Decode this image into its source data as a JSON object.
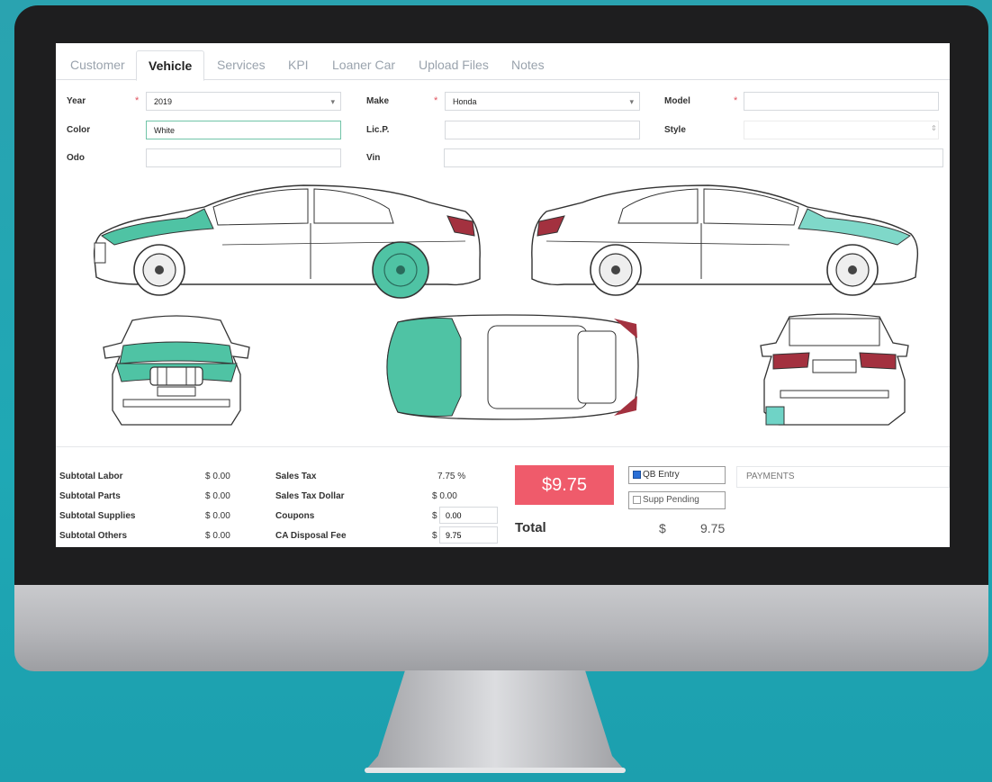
{
  "tabs": [
    "Customer",
    "Vehicle",
    "Services",
    "KPI",
    "Loaner Car",
    "Upload Files",
    "Notes"
  ],
  "active_tab": "Vehicle",
  "form": {
    "year_label": "Year",
    "year_value": "2019",
    "make_label": "Make",
    "make_value": "Honda",
    "model_label": "Model",
    "model_value": "",
    "color_label": "Color",
    "color_value": "White",
    "licp_label": "Lic.P.",
    "licp_value": "",
    "style_label": "Style",
    "style_value": "",
    "odo_label": "Odo",
    "odo_value": "",
    "vin_label": "Vin",
    "vin_value": "",
    "required_mark": "*"
  },
  "summary": {
    "subtotal_labor_label": "Subtotal Labor",
    "subtotal_labor": "$ 0.00",
    "subtotal_parts_label": "Subtotal Parts",
    "subtotal_parts": "$ 0.00",
    "subtotal_supplies_label": "Subtotal Supplies",
    "subtotal_supplies": "$ 0.00",
    "subtotal_others_label": "Subtotal Others",
    "subtotal_others": "$ 0.00",
    "sales_tax_label": "Sales Tax",
    "sales_tax": "7.75 %",
    "sales_tax_dollar_label": "Sales Tax Dollar",
    "sales_tax_dollar": "$ 0.00",
    "coupons_label": "Coupons",
    "coupons_currency": "$",
    "coupons_value": "0.00",
    "ca_disposal_label": "CA Disposal Fee",
    "ca_disposal_currency": "$",
    "ca_disposal_value": "9.75",
    "big_total": "$9.75",
    "qb_entry_label": "QB Entry",
    "qb_entry_checked": true,
    "supp_pending_label": "Supp Pending",
    "supp_pending_checked": false,
    "payments_label": "PAYMENTS",
    "total_label": "Total",
    "total_currency": "$",
    "total_value": "9.75"
  },
  "colors": {
    "accent_teal": "#4fc3a4",
    "damage_red": "#b23b3b",
    "big_total_bg": "#ef5b6b",
    "bg_teal": "#1fa8b5"
  }
}
